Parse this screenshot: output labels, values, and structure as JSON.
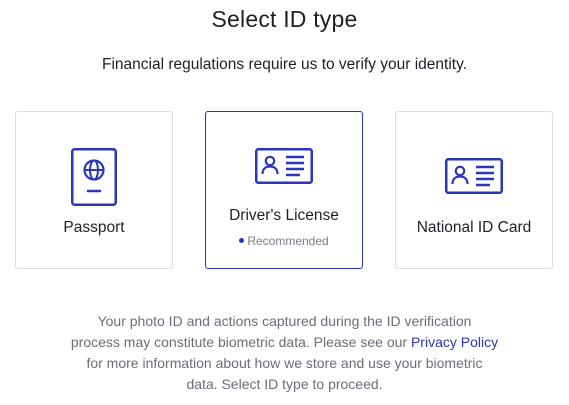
{
  "header": {
    "title": "Select ID type",
    "subtitle": "Financial regulations require us to verify your identity."
  },
  "colors": {
    "accent": "#2b36b8",
    "text": "#1e2025",
    "muted": "#6b6e76",
    "border": "#dcdee2"
  },
  "options": [
    {
      "label": "Passport",
      "icon": "passport-icon",
      "selected": false
    },
    {
      "label": "Driver's License",
      "icon": "id-card-icon",
      "selected": true,
      "badge": "Recommended"
    },
    {
      "label": "National ID Card",
      "icon": "id-card-icon",
      "selected": false
    }
  ],
  "disclaimer": {
    "line1": "Your photo ID and actions captured during the ID verification",
    "line2_text": "process may constitute biometric data. Please see our ",
    "privacy_link": "Privacy Policy",
    "line3": "for more information about how we store and use your biometric",
    "line4": "data. Select ID type to proceed."
  }
}
